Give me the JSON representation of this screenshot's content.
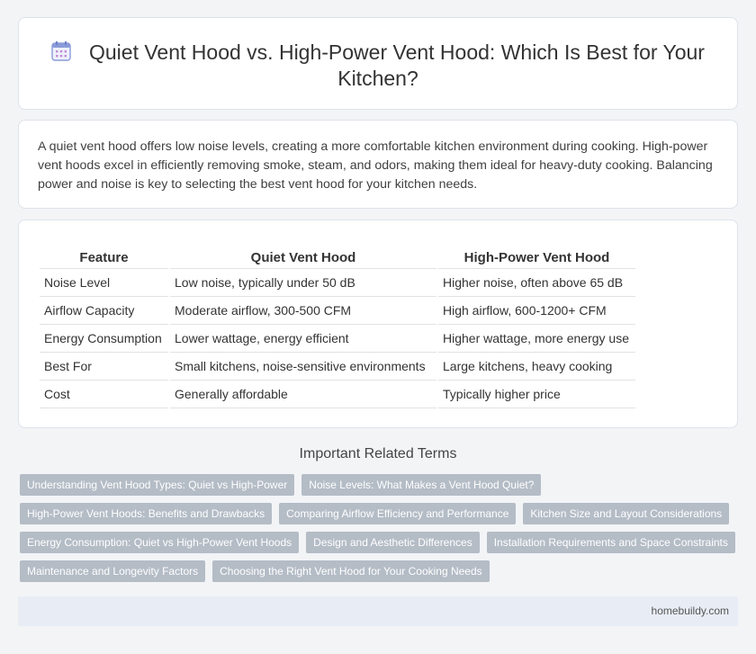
{
  "header": {
    "icon": "calendar-icon",
    "title": "Quiet Vent Hood vs. High-Power Vent Hood: Which Is Best for Your Kitchen?"
  },
  "intro": {
    "text": "A quiet vent hood offers low noise levels, creating a more comfortable kitchen environment during cooking. High-power vent hoods excel in efficiently removing smoke, steam, and odors, making them ideal for heavy-duty cooking. Balancing power and noise is key to selecting the best vent hood for your kitchen needs."
  },
  "comparison": {
    "headers": [
      "Feature",
      "Quiet Vent Hood",
      "High-Power Vent Hood"
    ],
    "rows": [
      [
        "Noise Level",
        "Low noise, typically under 50 dB",
        "Higher noise, often above 65 dB"
      ],
      [
        "Airflow Capacity",
        "Moderate airflow, 300-500 CFM",
        "High airflow, 600-1200+ CFM"
      ],
      [
        "Energy Consumption",
        "Lower wattage, energy efficient",
        "Higher wattage, more energy use"
      ],
      [
        "Best For",
        "Small kitchens, noise-sensitive environments",
        "Large kitchens, heavy cooking"
      ],
      [
        "Cost",
        "Generally affordable",
        "Typically higher price"
      ]
    ]
  },
  "related": {
    "heading": "Important Related Terms",
    "tags": [
      "Understanding Vent Hood Types: Quiet vs High-Power",
      "Noise Levels: What Makes a Vent Hood Quiet?",
      "High-Power Vent Hoods: Benefits and Drawbacks",
      "Comparing Airflow Efficiency and Performance",
      "Kitchen Size and Layout Considerations",
      "Energy Consumption: Quiet vs High-Power Vent Hoods",
      "Design and Aesthetic Differences",
      "Installation Requirements and Space Constraints",
      "Maintenance and Longevity Factors",
      "Choosing the Right Vent Hood for Your Cooking Needs"
    ]
  },
  "footer": {
    "site": "homebuildy.com"
  },
  "colors": {
    "tag_bg": "#b4bcc6",
    "footer_bg": "#e8edf5",
    "icon_accent": "#7b8fd8"
  }
}
